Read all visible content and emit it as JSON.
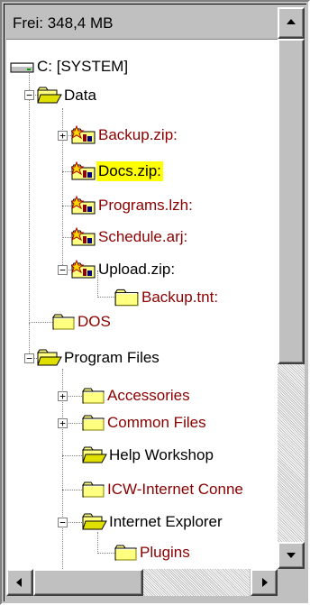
{
  "header": {
    "free_space": "Frei: 348,4 MB"
  },
  "tree": {
    "drive": "C: [SYSTEM]",
    "data_folder": "Data",
    "backup_zip": "Backup.zip:",
    "docs_zip": "Docs.zip:",
    "programs_lzh": "Programs.lzh:",
    "schedule_arj": "Schedule.arj:",
    "upload_zip": "Upload.zip:",
    "backup_tnt": "Backup.tnt:",
    "dos_folder": "DOS",
    "program_files_folder": "Program Files",
    "accessories": "Accessories",
    "common_files": "Common Files",
    "help_workshop": "Help Workshop",
    "icw": "ICW-Internet Conne",
    "internet_explorer": "Internet Explorer",
    "plugins": "Plugins"
  },
  "colors": {
    "unexpanded_text": "#8b0000",
    "selection_highlight": "#ffff00",
    "folder_yellow": "#ffff80"
  },
  "icons": [
    "drive-icon",
    "folder-icon",
    "open-folder-icon",
    "archive-icon",
    "tnt-icon",
    "plus-icon",
    "minus-icon",
    "scroll-up-icon",
    "scroll-down-icon",
    "scroll-left-icon",
    "scroll-right-icon"
  ]
}
